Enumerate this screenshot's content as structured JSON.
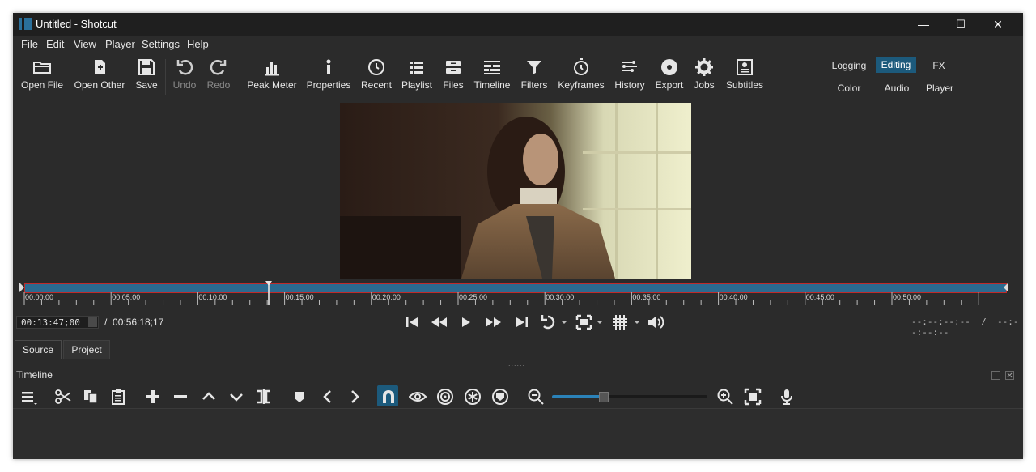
{
  "window": {
    "title": "Untitled - Shotcut",
    "minimize": "—",
    "maximize": "☐",
    "close": "✕"
  },
  "menu": [
    "File",
    "Edit",
    "View",
    "Player",
    "Settings",
    "Help"
  ],
  "toolbar": {
    "open_file": "Open File",
    "open_other": "Open Other",
    "save": "Save",
    "undo": "Undo",
    "redo": "Redo",
    "peak_meter": "Peak Meter",
    "properties": "Properties",
    "recent": "Recent",
    "playlist": "Playlist",
    "files": "Files",
    "timeline": "Timeline",
    "filters": "Filters",
    "keyframes": "Keyframes",
    "history": "History",
    "export": "Export",
    "jobs": "Jobs",
    "subtitles": "Subtitles"
  },
  "layouts": {
    "logging": "Logging",
    "editing": "Editing",
    "fx": "FX",
    "color": "Color",
    "audio": "Audio",
    "player": "Player",
    "active": "Editing"
  },
  "ruler": {
    "ticks": [
      "00:00:00",
      "00:05:00",
      "00:10:00",
      "00:15:00",
      "00:20:00",
      "00:25:00",
      "00:30:00",
      "00:35:00",
      "00:40:00",
      "00:45:00",
      "00:50:00"
    ],
    "playhead_position": "00:13:47;00"
  },
  "player": {
    "timecode": "00:13:47;00",
    "separator": "/",
    "duration": "00:56:18;17",
    "in_point": "--:--:--:--",
    "io_sep": "/",
    "out_point": "--:--:--:--"
  },
  "tabs": {
    "source": "Source",
    "project": "Project"
  },
  "timeline_panel": {
    "title": "Timeline",
    "grip": "......",
    "zoom_level": 0.33
  },
  "colors": {
    "accent": "#1c5a7c",
    "ruler_bar": "#2b6a90",
    "ruler_border": "#c02a2a",
    "background": "#2b2b2b"
  }
}
